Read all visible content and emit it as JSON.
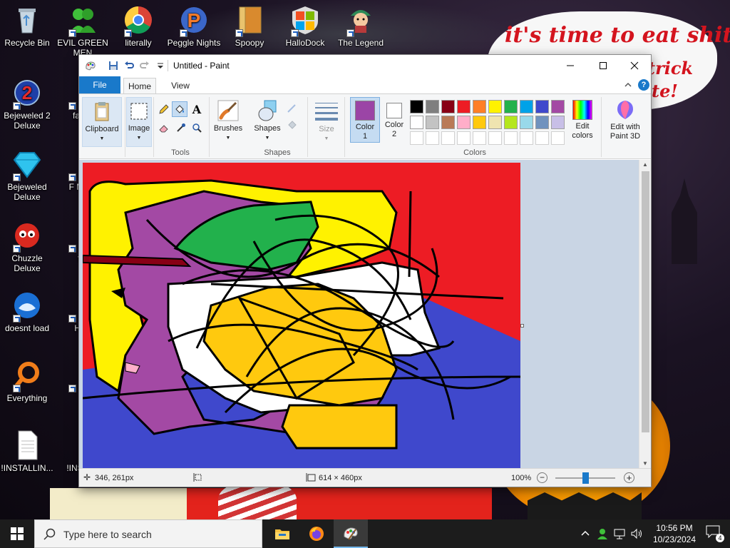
{
  "desktop": {
    "icons": [
      {
        "label": "Recycle Bin",
        "icon": "recycle-bin-icon"
      },
      {
        "label": "EVIL GREEN MEN",
        "icon": "green-men-icon"
      },
      {
        "label": "literally",
        "icon": "chrome-icon"
      },
      {
        "label": "Peggle Nights",
        "icon": "peggle-icon"
      },
      {
        "label": "Spoopy",
        "icon": "folder-icon"
      },
      {
        "label": "HalloDock",
        "icon": "windows-logo-icon"
      },
      {
        "label": "The Legend",
        "icon": "legend-character-icon"
      },
      {
        "label": "Bejeweled 2 Deluxe",
        "icon": "bejeweled-2-icon"
      },
      {
        "label": "fat lik",
        "icon": "app-icon"
      },
      {
        "label": "Bejeweled Deluxe",
        "icon": "diamond-icon"
      },
      {
        "label": "F MON",
        "icon": "app-icon"
      },
      {
        "label": "Chuzzle Deluxe",
        "icon": "chuzzle-icon"
      },
      {
        "label": "fur",
        "icon": "app-icon"
      },
      {
        "label": "doesnt load",
        "icon": "thunderbird-icon"
      },
      {
        "label": "H W",
        "icon": "app-icon"
      },
      {
        "label": "Everything",
        "icon": "everything-search-icon"
      },
      {
        "label": "is",
        "icon": "app-icon"
      },
      {
        "label": "!INSTALLIN...",
        "icon": "document-icon"
      },
      {
        "label": "!INS -Sh",
        "icon": "document-icon"
      }
    ],
    "bubble_text_1": "it's time to eat shit",
    "bubble_text_2": "trick",
    "bubble_text_3": "te!"
  },
  "paint": {
    "title": "Untitled - Paint",
    "tabs": {
      "file": "File",
      "home": "Home",
      "view": "View"
    },
    "ribbon": {
      "clipboard": "Clipboard",
      "image": "Image",
      "tools": "Tools",
      "brushes": "Brushes",
      "shapes_btn": "Shapes",
      "shapes_group": "Shapes",
      "size": "Size",
      "color1": "Color\n1",
      "color1_a": "Color",
      "color1_b": "1",
      "color2_a": "Color",
      "color2_b": "2",
      "colors_group": "Colors",
      "edit_colors_a": "Edit",
      "edit_colors_b": "colors",
      "paint3d_a": "Edit with",
      "paint3d_b": "Paint 3D"
    },
    "color1_value": "#9b45a6",
    "color2_value": "#ffffff",
    "palette_row1": [
      "#000000",
      "#7f7f7f",
      "#880015",
      "#ed1c24",
      "#ff7f27",
      "#fff200",
      "#22b14c",
      "#00a2e8",
      "#3f48cc",
      "#a349a4"
    ],
    "palette_row2": [
      "#ffffff",
      "#c3c3c3",
      "#b97a57",
      "#ffaec9",
      "#ffc90e",
      "#efe4b0",
      "#b5e61d",
      "#99d9ea",
      "#7092be",
      "#c8bfe7"
    ],
    "status": {
      "cursor": "346, 261px",
      "dimensions": "614 × 460px",
      "zoom": "100%"
    },
    "zoom_level": 100
  },
  "taskbar": {
    "search_placeholder": "Type here to search",
    "time": "10:56 PM",
    "date": "10/23/2024",
    "notification_count": "4",
    "apps": [
      "file-explorer-icon",
      "firefox-icon",
      "paint-icon"
    ]
  }
}
